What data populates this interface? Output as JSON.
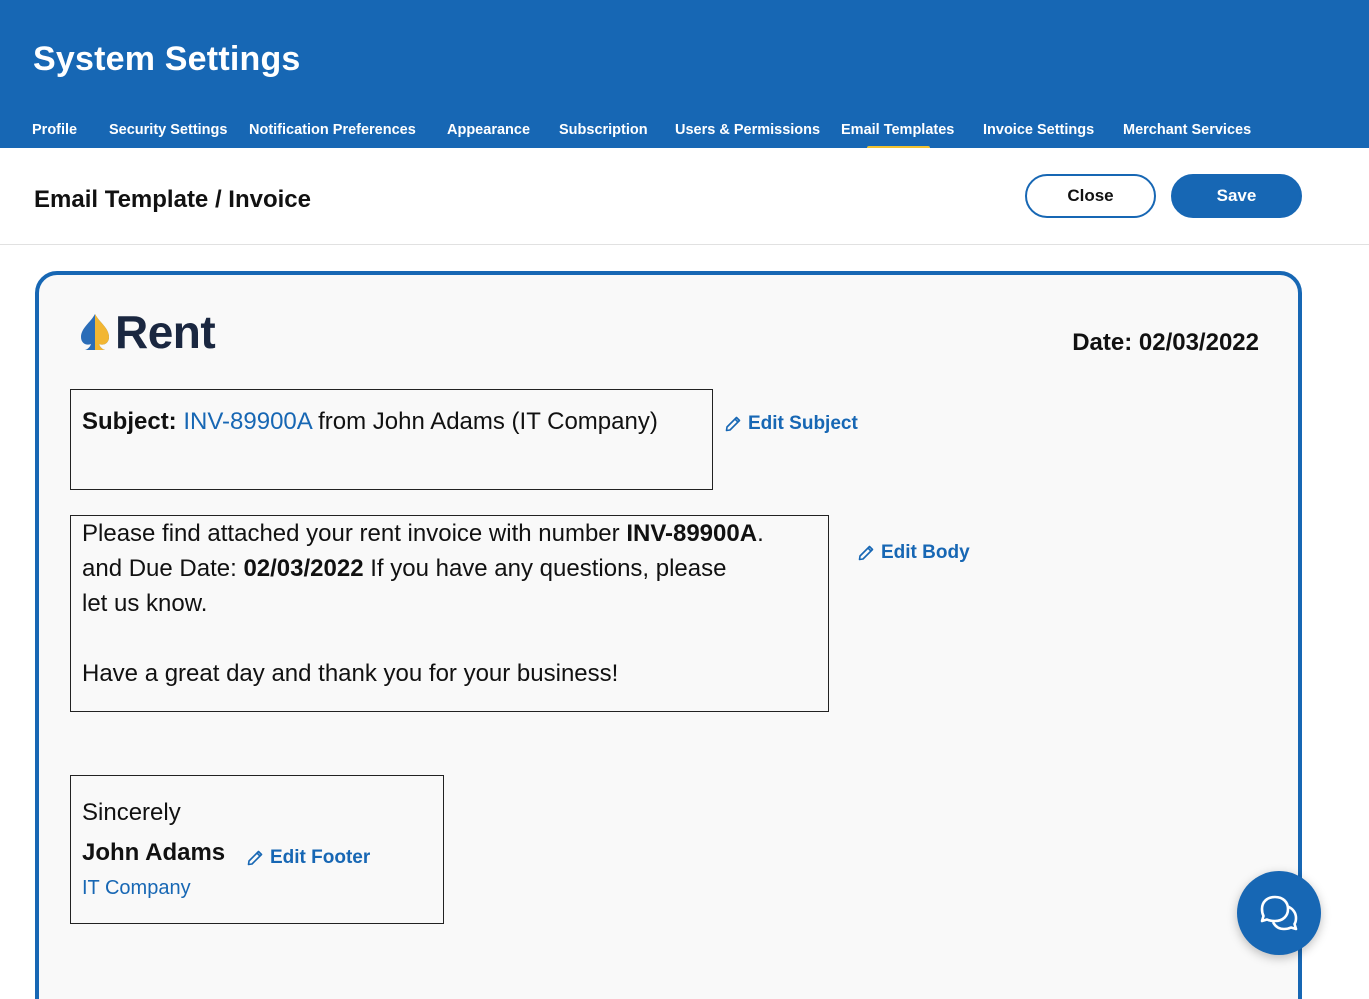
{
  "header": {
    "title": "System Settings",
    "tabs": [
      {
        "label": "Profile"
      },
      {
        "label": "Security Settings"
      },
      {
        "label": "Notification Preferences"
      },
      {
        "label": "Appearance"
      },
      {
        "label": "Subscription"
      },
      {
        "label": "Users & Permissions"
      },
      {
        "label": "Email Templates",
        "active": true
      },
      {
        "label": "Invoice Settings"
      },
      {
        "label": "Merchant Services"
      }
    ]
  },
  "toolbar": {
    "title": "Email Template / Invoice",
    "close_label": "Close",
    "save_label": "Save"
  },
  "template": {
    "logo_text": "Rent",
    "date_label": "Date:",
    "date_value": "02/03/2022",
    "subject": {
      "label": "Subject:",
      "invoice_number": "INV-89900A",
      "rest": "from John Adams (IT Company)",
      "edit_label": "Edit Subject"
    },
    "body": {
      "line1_prefix": "Please find attached your rent invoice with number ",
      "invoice_number": "INV-89900A",
      "line1_suffix": ".",
      "due_prefix": "and Due Date: ",
      "due_date": "02/03/2022",
      "due_suffix": " If you have any questions, please",
      "line3": "let us know.",
      "closing": "Have a great day and thank you for your business!",
      "edit_label": "Edit Body"
    },
    "footer": {
      "sincerely": "Sincerely",
      "signer": "John Adams",
      "company": "IT Company",
      "edit_label": "Edit Footer"
    }
  },
  "colors": {
    "primary": "#1767b4",
    "tab_indicator": "#f2c230",
    "logo_text": "#1a2740"
  },
  "icons": {
    "edit": "pencil-icon",
    "chat": "chat-bubbles-icon",
    "logo": "spade-drop-logo"
  }
}
